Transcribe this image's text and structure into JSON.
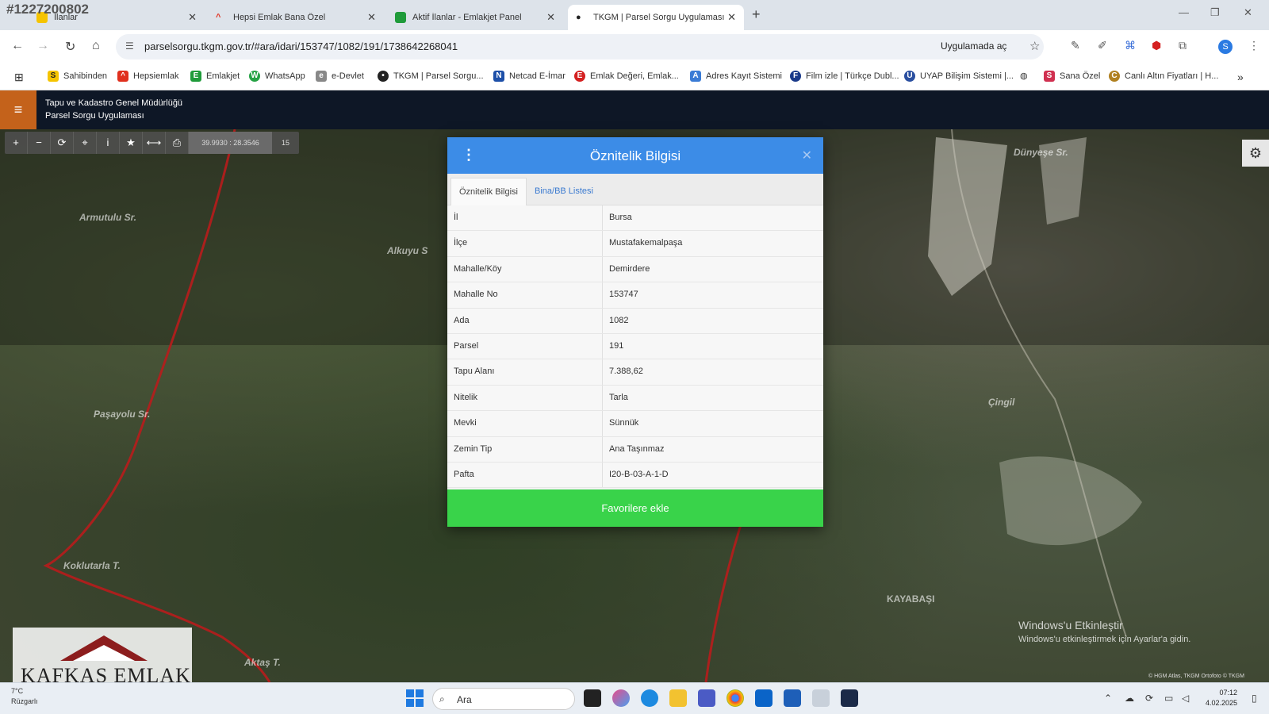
{
  "watermark_id": "#1227200802",
  "browser": {
    "tabs": [
      {
        "label": "İlanlar"
      },
      {
        "label": "Hepsi Emlak Bana Özel"
      },
      {
        "label": "Aktif İlanlar - Emlakjet Panel"
      },
      {
        "label": "TKGM | Parsel Sorgu Uygulaması",
        "active": true
      }
    ],
    "url": "parselsorgu.tkgm.gov.tr/#ara/idari/153747/1082/191/1738642268041",
    "open_in_app": "Uygulamada aç",
    "bookmarks": [
      {
        "label": "Sahibinden",
        "color": "#f5c400",
        "glyph": "S"
      },
      {
        "label": "Hepsiemlak",
        "color": "#e0301e",
        "glyph": "^"
      },
      {
        "label": "Emlakjet",
        "color": "#1f9b3a",
        "glyph": "E"
      },
      {
        "label": "WhatsApp",
        "color": "#25a244",
        "glyph": "W"
      },
      {
        "label": "e-Devlet",
        "color": "#888888",
        "glyph": "e"
      },
      {
        "label": "TKGM | Parsel Sorgu...",
        "color": "#222222",
        "glyph": "•"
      },
      {
        "label": "Netcad E-İmar",
        "color": "#1d4fa8",
        "glyph": "N"
      },
      {
        "label": "Emlak Değeri, Emlak...",
        "color": "#d42020",
        "glyph": "E"
      },
      {
        "label": "Adres Kayıt Sistemi",
        "color": "#3a7bd5",
        "glyph": "A"
      },
      {
        "label": "Film izle | Türkçe Dubl...",
        "color": "#1a3a8a",
        "glyph": "F"
      },
      {
        "label": "UYAP Bilişim Sistemi |...",
        "color": "#2a4fa0",
        "glyph": "U"
      },
      {
        "label": "Sana Özel",
        "color": "#d03050",
        "glyph": "S"
      },
      {
        "label": "Canlı Altın Fiyatları | H...",
        "color": "#b08020",
        "glyph": "C"
      }
    ]
  },
  "app": {
    "title_line1": "Tapu ve Kadastro Genel Müdürlüğü",
    "title_line2": "Parsel Sorgu Uygulaması"
  },
  "map": {
    "coords": "39.9930 : 28.3546",
    "zoom": "15",
    "labels": [
      {
        "text": "Armutulu Sr."
      },
      {
        "text": "Alkuyu S"
      },
      {
        "text": "Paşayolu Sr."
      },
      {
        "text": "Koklutarla T."
      },
      {
        "text": "Aktaş T."
      },
      {
        "text": "Çingil"
      },
      {
        "text": "KAYABAŞI"
      },
      {
        "text": "Dünyeşe Sr."
      }
    ],
    "windows_activation_title": "Windows'u Etkinleştir",
    "windows_activation_sub": "Windows'u etkinleştirmek için Ayarlar'a gidin.",
    "logo_text": "KAFKAS EMLAK",
    "copyright": "© HGM Atlas, TKGM Ortofoto © TKGM"
  },
  "dialog": {
    "title": "Öznitelik Bilgisi",
    "tabs": [
      {
        "label": "Öznitelik Bilgisi",
        "active": true
      },
      {
        "label": "Bina/BB Listesi",
        "active": false
      }
    ],
    "rows": [
      {
        "key": "İl",
        "value": "Bursa"
      },
      {
        "key": "İlçe",
        "value": "Mustafakemalpaşa"
      },
      {
        "key": "Mahalle/Köy",
        "value": "Demirdere"
      },
      {
        "key": "Mahalle No",
        "value": "153747"
      },
      {
        "key": "Ada",
        "value": "1082"
      },
      {
        "key": "Parsel",
        "value": "191"
      },
      {
        "key": "Tapu Alanı",
        "value": "7.388,62"
      },
      {
        "key": "Nitelik",
        "value": "Tarla"
      },
      {
        "key": "Mevki",
        "value": "Sünnük"
      },
      {
        "key": "Zemin Tip",
        "value": "Ana Taşınmaz"
      },
      {
        "key": "Pafta",
        "value": "I20-B-03-A-1-D"
      }
    ],
    "favorite_button": "Favorilere ekle",
    "header_color": "#3c8ce7",
    "button_color": "#39d34a"
  },
  "taskbar": {
    "weather_temp": "7°C",
    "weather_text": "Rüzgarlı",
    "search_placeholder": "Ara",
    "time": "07:12",
    "date": "4.02.2025"
  }
}
